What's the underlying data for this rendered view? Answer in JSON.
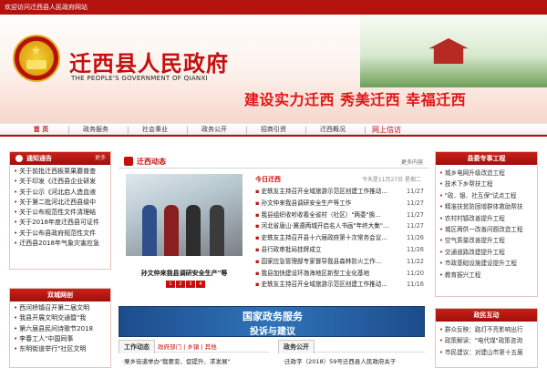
{
  "header": {
    "welcome": "欢迎访问迁西县人民政府网站",
    "title": "迁西县人民政府",
    "subtitle": "THE PEOPLE'S GOVERNMENT OF QIANXI",
    "slogan": "建设实力迁西  秀美迁西  幸福迁西"
  },
  "nav": {
    "items": [
      "首 页",
      "政务服务",
      "社会事业",
      "政务公开",
      "招商引资",
      "迁西概况"
    ],
    "extra": "网上信访"
  },
  "notice": {
    "title": "通知通告",
    "more": "更多",
    "items": [
      "关于前批迁西板栗果蘑普查",
      "关于印发《迁西县企业研发",
      "关于公示《河北启人造血液",
      "关于第二批河北迁西县级中",
      "关于公布规范性文件清理结",
      "关于2018年度迁西县可证件",
      "关于公布县政府规范性文件",
      "迁西县2018年气象灾害应急"
    ]
  },
  "network": {
    "title": "双城网创",
    "items": [
      "西河桥镇召开第二届文明",
      "我县开展文明交通暨\"我",
      "第六届县民间诗歌节2018",
      "李春工人\"中国同事",
      "东明街道举行\"社区文明"
    ]
  },
  "news": {
    "title": "迁西动态",
    "more": "更多内容",
    "caption": "孙文仲来我县调研安全生产\"等",
    "pager": [
      "1",
      "2",
      "3",
      "4"
    ],
    "today": "今日迁西",
    "date": "今天是11月27日  星期二",
    "items": [
      {
        "t": "史轶友主持召开全域旅游示范区创建工作推动…",
        "d": "11/27"
      },
      {
        "t": "孙文仲来我县调研安全生产等工作",
        "d": "11/27"
      },
      {
        "t": "我县组织收听收看全省村（社区）\"两委\"换…",
        "d": "11/27"
      },
      {
        "t": "河北省唐山·冀遵两城开启名人书画\"年终大集\"…",
        "d": "11/27"
      },
      {
        "t": "史轶友主持召开县十六届政府第十次常务会议…",
        "d": "11/26"
      },
      {
        "t": "县行政审批局挂牌成立",
        "d": "11/26"
      },
      {
        "t": "国家应急管理部专家督导我县森林防火工作…",
        "d": "11/22"
      },
      {
        "t": "我县加快建设环渤海地区新型工业化基地",
        "d": "11/20"
      },
      {
        "t": "史轶友主持召开全域旅游示范区创建工作推动…",
        "d": "11/16"
      }
    ]
  },
  "promo": {
    "line1": "国家政务服务",
    "line2": "投诉与建议"
  },
  "work": {
    "title": "工作动态",
    "links": "政府部门 | 乡镇 | 其他",
    "first": "·栗乡街道举办\"我要变、促提升、求发展\""
  },
  "open": {
    "title": "政务公开",
    "first": "·迁政字（2018）59号迁西县人民政府关于"
  },
  "special": {
    "title": "县委专事工程",
    "items": [
      "城乡电网升级改造工程",
      "技术下乡帮扶工程",
      "\"政、银、社互保\"试点工程",
      "精准扶贫防困增群体救助帮扶",
      "农村村镇改善提升工程",
      "城区两供一改善问题改造工程",
      "空气质量改善提升工程",
      "交通道路改建提升工程",
      "市政基础设施建设提升工程",
      "教育振兴工程"
    ]
  },
  "interact": {
    "title": "政民互动",
    "items": [
      "群众反映：路灯不亮影响出行",
      "政策解读：\"电代煤\"政策咨询",
      "市民建议：对建山市第十五届"
    ]
  }
}
